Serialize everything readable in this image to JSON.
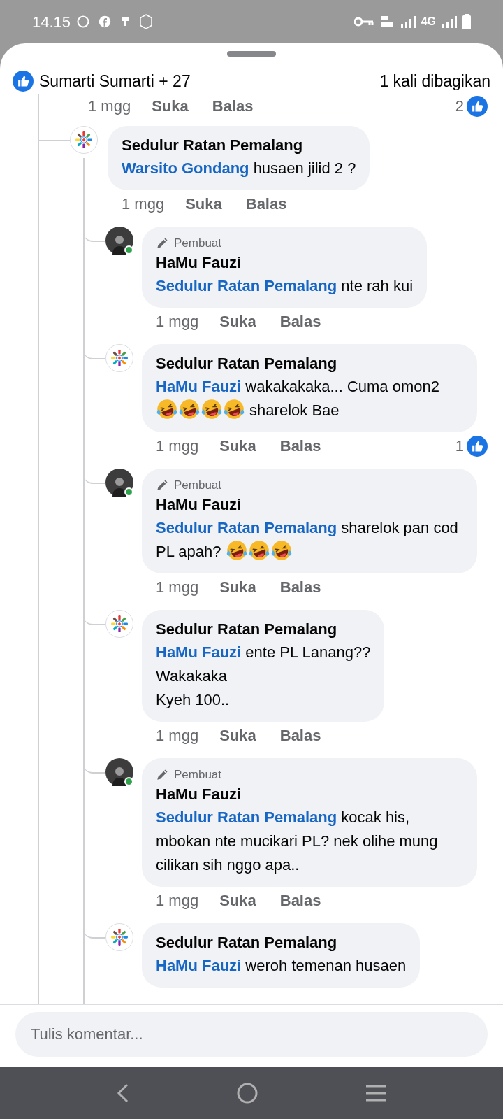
{
  "status_bar": {
    "time": "14.15",
    "network": "4G"
  },
  "header": {
    "likes": "Sumarti Sumarti + 27",
    "shares": "1 kali dibagikan"
  },
  "previous_meta": {
    "time": "1 mgg",
    "like": "Suka",
    "reply": "Balas",
    "reaction_count": "2"
  },
  "comments": [
    {
      "author": "Sedulur Ratan Pemalang",
      "kind": "page",
      "online": false,
      "parts": [
        {
          "kind": "mention",
          "text": "Warsito Gondang"
        },
        {
          "kind": "text",
          "text": " husaen jilid 2 ?"
        }
      ],
      "time": "1 mgg",
      "like": "Suka",
      "reply": "Balas",
      "children": [
        {
          "author": "HaMu Fauzi",
          "kind": "person",
          "online": true,
          "badge": "Pembuat",
          "parts": [
            {
              "kind": "mention",
              "text": "Sedulur Ratan Pemalang"
            },
            {
              "kind": "text",
              "text": " nte rah kui"
            }
          ],
          "time": "1 mgg",
          "like": "Suka",
          "reply": "Balas"
        },
        {
          "author": "Sedulur Ratan Pemalang",
          "kind": "page",
          "online": false,
          "parts": [
            {
              "kind": "mention",
              "text": "HaMu Fauzi"
            },
            {
              "kind": "text",
              "text": " wakakakaka... Cuma omon2 "
            },
            {
              "kind": "emoji"
            },
            {
              "kind": "emoji"
            },
            {
              "kind": "emoji"
            },
            {
              "kind": "emoji"
            },
            {
              "kind": "text",
              "text": " sharelok Bae"
            }
          ],
          "time": "1 mgg",
          "like": "Suka",
          "reply": "Balas",
          "reaction_count": "1"
        },
        {
          "author": "HaMu Fauzi",
          "kind": "person",
          "online": true,
          "badge": "Pembuat",
          "parts": [
            {
              "kind": "mention",
              "text": "Sedulur Ratan Pemalang"
            },
            {
              "kind": "text",
              "text": " sharelok pan cod PL apah? "
            },
            {
              "kind": "emoji"
            },
            {
              "kind": "emoji"
            },
            {
              "kind": "emoji"
            }
          ],
          "time": "1 mgg",
          "like": "Suka",
          "reply": "Balas"
        },
        {
          "author": "Sedulur Ratan Pemalang",
          "kind": "page",
          "online": false,
          "parts": [
            {
              "kind": "mention",
              "text": "HaMu Fauzi"
            },
            {
              "kind": "text",
              "text": " ente PL Lanang??\nWakakaka\nKyeh 100.."
            }
          ],
          "time": "1 mgg",
          "like": "Suka",
          "reply": "Balas"
        },
        {
          "author": "HaMu Fauzi",
          "kind": "person",
          "online": true,
          "badge": "Pembuat",
          "parts": [
            {
              "kind": "mention",
              "text": "Sedulur Ratan Pemalang"
            },
            {
              "kind": "text",
              "text": " kocak his, mbokan nte mucikari PL? nek olihe mung cilikan sih nggo apa.."
            }
          ],
          "time": "1 mgg",
          "like": "Suka",
          "reply": "Balas"
        },
        {
          "author": "Sedulur Ratan Pemalang",
          "kind": "page",
          "online": false,
          "parts": [
            {
              "kind": "mention",
              "text": "HaMu Fauzi"
            },
            {
              "kind": "text",
              "text": " weroh temenan husaen"
            }
          ]
        }
      ]
    }
  ],
  "composer": {
    "placeholder": "Tulis komentar..."
  }
}
